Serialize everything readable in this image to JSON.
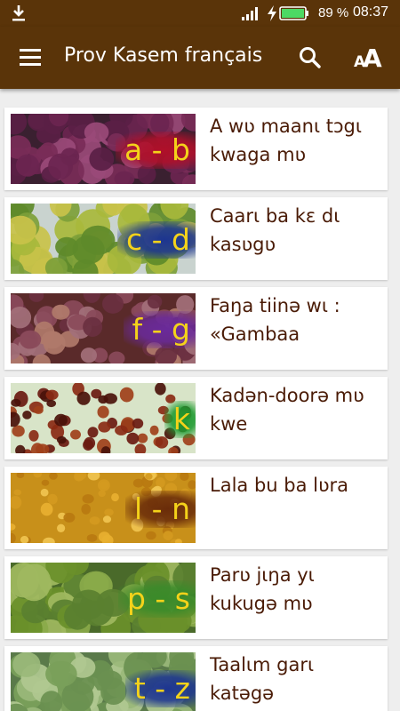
{
  "status_bar": {
    "download_icon": "download-icon",
    "signal_icon": "signal-icon",
    "charging_icon": "charging-icon",
    "battery_icon": "battery-icon",
    "battery": "89 %",
    "time": "08:37"
  },
  "app_bar": {
    "menu_icon": "menu-icon",
    "title": "Prov Kasem français",
    "search_icon": "search-icon",
    "text_size_icon": "text-size-icon",
    "text_size_glyph": "AA"
  },
  "colors": {
    "primary": "#5a3409",
    "title_text": "#4a1b06",
    "letters": "#f4d21a",
    "background": "#eeeeee"
  },
  "chapters": [
    {
      "letters": "a - b",
      "title": "A wʋ maanɩ tɔgɩ kwaga mʋ",
      "badge_color": "#b0102a",
      "photo": "purple-fruits"
    },
    {
      "letters": "c - d",
      "title": "Caarɩ ba kɛ dɩ kasʋgʋ",
      "badge_color": "#1d3590",
      "photo": "green-fruits-on-tree"
    },
    {
      "letters": "f - g",
      "title": "Faŋa tiinə wɩ : «Gambaa",
      "badge_color": "#6a2a9a",
      "photo": "purple-nuts"
    },
    {
      "letters": "k",
      "title": "Kadən-doorə mʋ kwe",
      "badge_color": "#1d9a30",
      "photo": "palm-fruit-bunch"
    },
    {
      "letters": "l - n",
      "title": "Lala bu ba lʋra",
      "badge_color": "#6a2c0a",
      "photo": "grains"
    },
    {
      "letters": "p - s",
      "title": "Parʋ jɩŋa yɩ kukugə mʋ",
      "badge_color": "#3a8a2a",
      "photo": "mangoes"
    },
    {
      "letters": "t - z",
      "title": "Taalɩm garɩ katəgə",
      "badge_color": "#1d3590",
      "photo": "green-fruits-hanging"
    }
  ]
}
